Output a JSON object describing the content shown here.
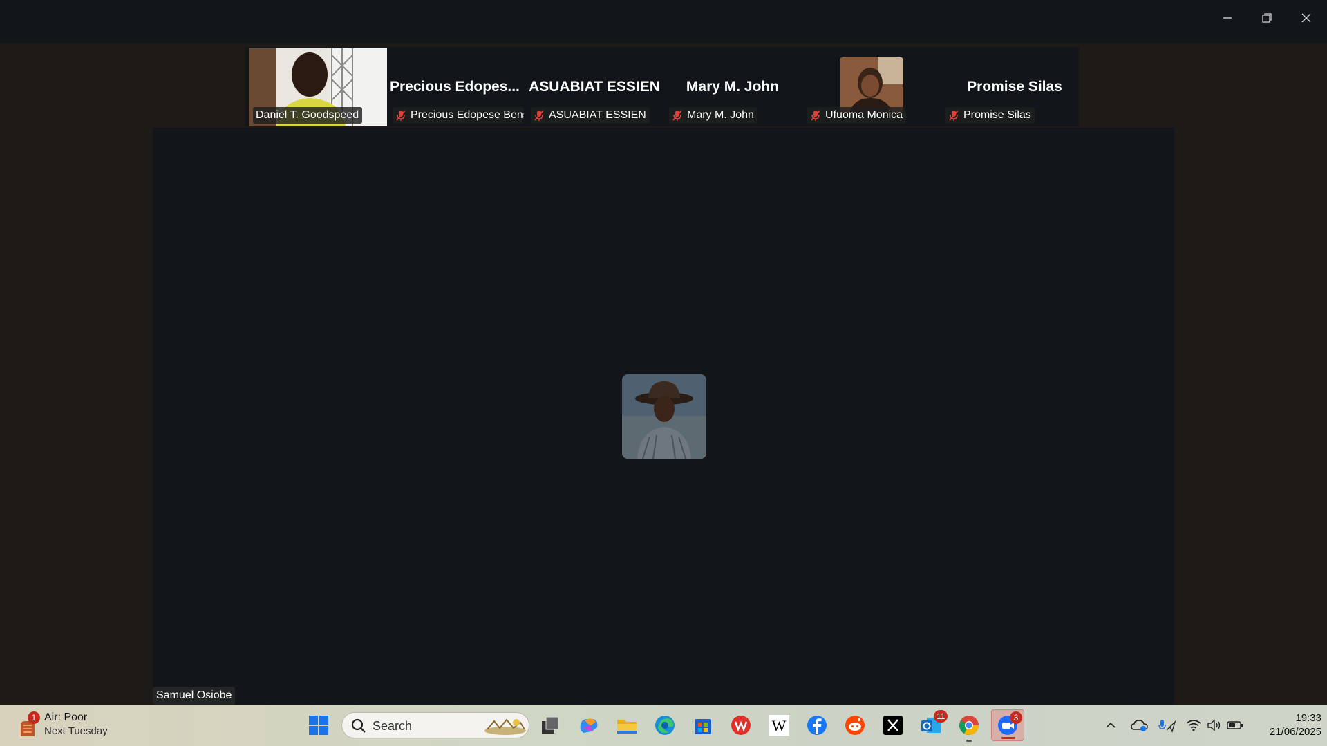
{
  "window": {
    "minimize_label": "Minimize",
    "restore_label": "Restore",
    "close_label": "Close"
  },
  "strip": {
    "participants": [
      {
        "display_name": "",
        "label": "Daniel T. Goodspeed",
        "video": true,
        "muted": false
      },
      {
        "display_name": "Precious  Edopes...",
        "label": "Precious Edopese Bens...",
        "video": false,
        "muted": true
      },
      {
        "display_name": "ASUABIAT ESSIEN",
        "label": "ASUABIAT ESSIEN",
        "video": false,
        "muted": true
      },
      {
        "display_name": "Mary M. John",
        "label": "Mary M. John",
        "video": false,
        "muted": true
      },
      {
        "display_name": "",
        "label": "Ufuoma Monica",
        "video": true,
        "muted": true
      },
      {
        "display_name": "Promise Silas",
        "label": "Promise Silas",
        "video": false,
        "muted": true
      }
    ]
  },
  "main": {
    "speaker_label": "Samuel Osiobe"
  },
  "taskbar": {
    "weather": {
      "line1": "Air: Poor",
      "line2": "Next Tuesday",
      "badge": "1"
    },
    "search_placeholder": "Search",
    "apps": [
      {
        "name": "start",
        "icon": "windows-logo-icon"
      },
      {
        "name": "task-view",
        "icon": "task-view-icon"
      },
      {
        "name": "copilot",
        "icon": "copilot-icon"
      },
      {
        "name": "file-explorer",
        "icon": "folder-icon"
      },
      {
        "name": "edge",
        "icon": "edge-icon"
      },
      {
        "name": "store",
        "icon": "store-icon"
      },
      {
        "name": "wps",
        "icon": "wps-icon"
      },
      {
        "name": "wikipedia",
        "icon": "wikipedia-icon"
      },
      {
        "name": "facebook",
        "icon": "facebook-icon"
      },
      {
        "name": "reddit",
        "icon": "reddit-icon"
      },
      {
        "name": "x",
        "icon": "x-icon"
      },
      {
        "name": "outlook",
        "icon": "outlook-icon",
        "badge": "11"
      },
      {
        "name": "chrome",
        "icon": "chrome-icon"
      },
      {
        "name": "zoom",
        "icon": "zoom-icon",
        "badge": "3"
      }
    ],
    "clock": {
      "time": "19:33",
      "date": "21/06/2025"
    }
  },
  "colors": {
    "mic_muted": "#e0413a",
    "accent_active": "#c42b1c",
    "zoom_blue": "#1f6bff"
  }
}
